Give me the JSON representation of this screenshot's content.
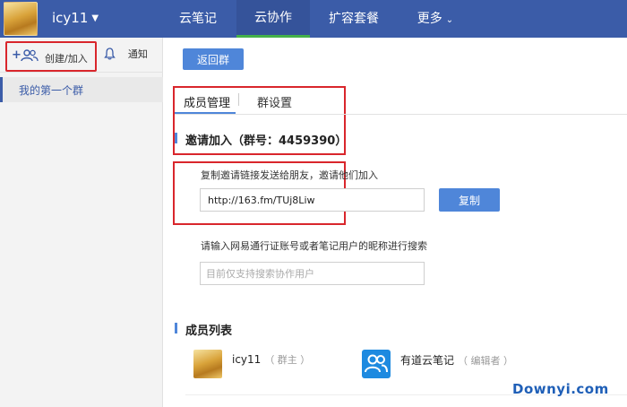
{
  "topbar": {
    "username": "icy11",
    "nav": [
      "云笔记",
      "云协作",
      "扩容套餐",
      "更多"
    ],
    "active_nav": "云协作"
  },
  "sidebar": {
    "create_label": "创建/加入",
    "notify_label": "通知",
    "group_name": "我的第一个群"
  },
  "main": {
    "back_button": "返回群",
    "tabs": [
      {
        "label": "成员管理"
      },
      {
        "label": "群设置"
      }
    ],
    "invite_title": "邀请加入（群号：4459390）",
    "copy_hint": "复制邀请链接发送给朋友，邀请他们加入",
    "invite_link": "http://163.fm/TUj8Liw",
    "copy_button": "复制",
    "search_hint": "请输入网易通行证账号或者笔记用户的昵称进行搜索",
    "search_placeholder": "目前仅支持搜索协作用户",
    "members_title": "成员列表",
    "members": [
      {
        "name": "icy11",
        "role": "（ 群主 ）"
      },
      {
        "name": "有道云笔记",
        "role": "（ 编辑者 ）"
      }
    ]
  },
  "watermark": "Downyi.com",
  "colors": {
    "header": "#3b5ca8",
    "button": "#4f86d9",
    "highlight_border": "#d9262c",
    "active_tab_indicator": "#45b04a"
  }
}
